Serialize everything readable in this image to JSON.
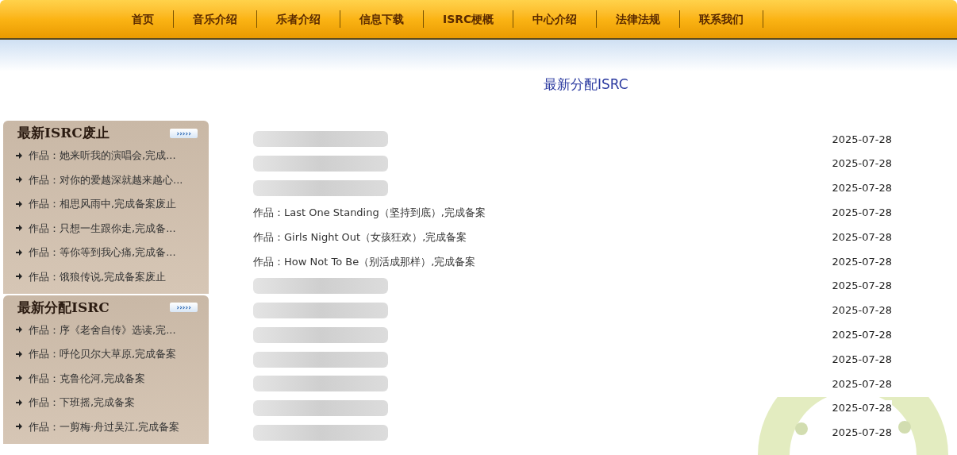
{
  "nav": [
    {
      "label": "首页"
    },
    {
      "label": "音乐介绍"
    },
    {
      "label": "乐者介绍"
    },
    {
      "label": "信息下载"
    },
    {
      "label": "ISRC梗概"
    },
    {
      "label": "中心介绍"
    },
    {
      "label": "法律法规"
    },
    {
      "label": "联系我们"
    }
  ],
  "sidebar": [
    {
      "title": "最新ISRC废止",
      "more": "›››››",
      "items": [
        "作品：她来听我的演唱会,完成...",
        "作品：对你的爱越深就越来越心...",
        "作品：相思风雨中,完成备案废止",
        "作品：只想一生跟你走,完成备...",
        "作品：等你等到我心痛,完成备...",
        "作品：饿狼传说,完成备案废止"
      ]
    },
    {
      "title": "最新分配ISRC",
      "more": "›››››",
      "items": [
        "作品：序《老舍自传》选读,完...",
        "作品：呼伦贝尔大草原,完成备案",
        "作品：克鲁伦河,完成备案",
        "作品：下班摇,完成备案",
        "作品：一剪梅·舟过吴江,完成备案"
      ]
    }
  ],
  "main": {
    "title": "最新分配ISRC",
    "rows": [
      {
        "kind": "redacted",
        "date": "2025-07-28"
      },
      {
        "kind": "redacted",
        "date": "2025-07-28"
      },
      {
        "kind": "redacted",
        "date": "2025-07-28"
      },
      {
        "kind": "text",
        "title": "作品：Last One Standing（坚持到底）,完成备案",
        "date": "2025-07-28"
      },
      {
        "kind": "text",
        "title": "作品：Girls Night Out（女孩狂欢）,完成备案",
        "date": "2025-07-28"
      },
      {
        "kind": "text",
        "title": "作品：How Not To Be（别活成那样）,完成备案",
        "date": "2025-07-28"
      },
      {
        "kind": "redacted",
        "date": "2025-07-28"
      },
      {
        "kind": "redacted",
        "date": "2025-07-28"
      },
      {
        "kind": "redacted",
        "date": "2025-07-28"
      },
      {
        "kind": "redacted",
        "date": "2025-07-28"
      },
      {
        "kind": "redacted",
        "date": "2025-07-28"
      },
      {
        "kind": "redacted",
        "date": "2025-07-28"
      },
      {
        "kind": "redacted",
        "date": "2025-07-28"
      }
    ]
  }
}
